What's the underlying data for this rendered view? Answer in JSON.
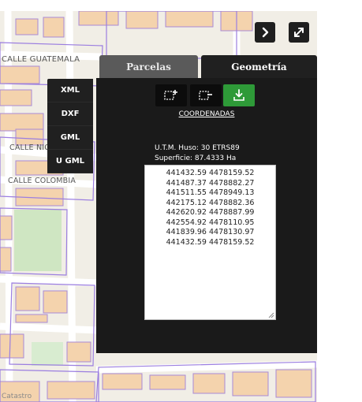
{
  "map": {
    "streets": [
      "CALLE GUATEMALA",
      "CALLE NICARAGUA",
      "CALLE COLOMBIA"
    ],
    "credit": "Catastro"
  },
  "controls": {
    "next_icon": "chevron-right-icon",
    "fullscreen_icon": "expand-icon"
  },
  "export": {
    "buttons": [
      "XML",
      "DXF",
      "GML",
      "U GML"
    ]
  },
  "tabs": {
    "parcelas": "Parcelas",
    "geometria": "Geometría"
  },
  "tools": {
    "add_icon": "add-feature-icon",
    "remove_icon": "remove-feature-icon",
    "download_icon": "download-icon",
    "accent": "#2e9a38"
  },
  "panel": {
    "title": "COORDENADAS",
    "utm": "U.T.M. Huso: 30 ETRS89",
    "surface": "Superficie: 87.4333 Ha",
    "coordinates": [
      "441432.59 4478159.52",
      "441487.37 4478882.27",
      "441511.55 4478949.13",
      "442175.12 4478882.36",
      "442620.92 4478887.99",
      "442554.92 4478110.95",
      "441839.96 4478130.97",
      "441432.59 4478159.52"
    ]
  }
}
